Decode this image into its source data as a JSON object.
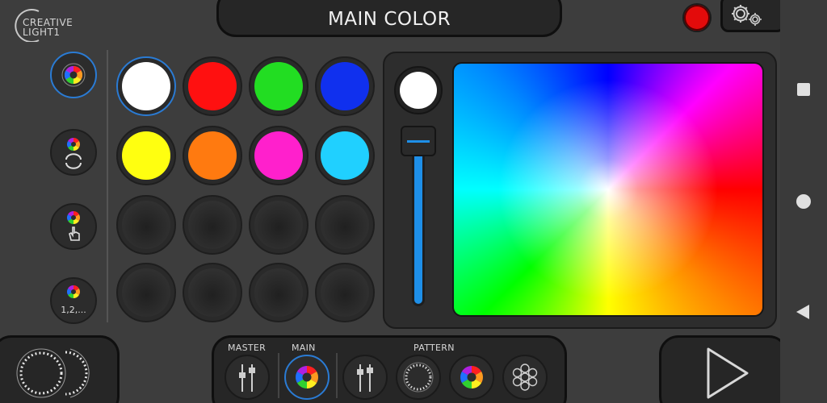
{
  "header": {
    "logo_line1": "CREATIVE",
    "logo_line2": "LIGHT1",
    "title": "MAIN COLOR",
    "record_icon": "record-icon",
    "settings_icon": "gears-icon"
  },
  "sidebar": {
    "items": [
      {
        "name": "color-wheel",
        "icon": "color-wheel-icon",
        "active": true
      },
      {
        "name": "color-cycle",
        "icon": "color-wheel-cycle-icon",
        "active": false
      },
      {
        "name": "color-touch",
        "icon": "color-wheel-hand-icon",
        "active": false
      },
      {
        "name": "color-sequence",
        "icon": "color-wheel-sequence-icon",
        "label": "1,2,...",
        "active": false
      }
    ]
  },
  "swatches": {
    "rows": [
      [
        "#ffffff",
        "#ff1010",
        "#22dd22",
        "#1030ee"
      ],
      [
        "#ffff10",
        "#ff7a10",
        "#ff20cc",
        "#20d0ff"
      ],
      [
        "",
        "",
        "",
        ""
      ],
      [
        "",
        "",
        "",
        ""
      ]
    ],
    "selected": "#ffffff"
  },
  "picker": {
    "current_color": "#ffffff",
    "brightness": 0.95,
    "slider_color": "#1e8fe8"
  },
  "bottom_bar": {
    "tabs": [
      {
        "label": "MASTER",
        "icon": "faders-icon",
        "active": false
      },
      {
        "label": "MAIN",
        "icon": "color-wheel-icon",
        "active": true
      },
      {
        "label": "",
        "icon": "faders-icon",
        "active": false
      },
      {
        "label": "PATTERN",
        "icon": "dotted-ring-icon",
        "active": false
      },
      {
        "label": "",
        "icon": "color-wheel-icon",
        "active": false
      },
      {
        "label": "",
        "icon": "led-cluster-icon",
        "active": false
      }
    ],
    "left_icon": "dual-ring-icon",
    "play_icon": "play-icon"
  },
  "colors": {
    "accent": "#2a7bd4",
    "background": "#3d3d3d",
    "panel": "#262626",
    "record": "#e30b0b"
  }
}
